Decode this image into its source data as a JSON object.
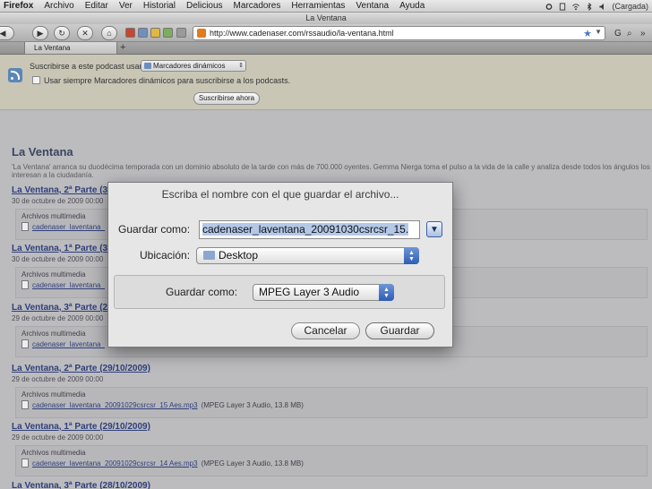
{
  "menubar": {
    "app": "Firefox",
    "items": [
      "Archivo",
      "Editar",
      "Ver",
      "Historial",
      "Delicious",
      "Marcadores",
      "Herramientas",
      "Ventana",
      "Ayuda"
    ],
    "status": "(Cargada)"
  },
  "window": {
    "title": "La Ventana"
  },
  "navbar": {
    "url": "http://www.cadenaser.com/rssaudio/la-ventana.html"
  },
  "tabs": [
    {
      "label": "La Ventana"
    }
  ],
  "subscribe": {
    "prompt": "Suscribirse a este podcast usando",
    "reader": "Marcadores dinámicos",
    "always_label": "Usar siempre Marcadores dinámicos para suscribirse a los podcasts.",
    "button": "Suscribirse ahora"
  },
  "feed": {
    "title": "La Ventana",
    "description_line1": "'La Ventana' arranca su duodécima temporada con un dominio absoluto de la tarde con más de 700.000 oyentes. Gemma Nierga toma el pulso a la vida de la calle y analiza desde todos los ángulos los",
    "description_line2": "interesan a la ciudadanía."
  },
  "entries": [
    {
      "title": "La Ventana, 2ª Parte (30/1",
      "date": "30 de octubre de 2009 00:00",
      "media_label": "Archivos multimedia",
      "file": "cadenaser_laventana_",
      "info": ""
    },
    {
      "title": "La Ventana, 1ª Parte (30/1",
      "date": "30 de octubre de 2009 00:00",
      "media_label": "Archivos multimedia",
      "file": "cadenaser_laventana_",
      "info": ""
    },
    {
      "title": "La Ventana, 3ª Parte (29/1",
      "date": "29 de octubre de 2009 00:00",
      "media_label": "Archivos multimedia",
      "file": "cadenaser_laventana_",
      "info": ""
    },
    {
      "title": "La Ventana, 2ª Parte (29/10/2009)",
      "date": "29 de octubre de 2009 00:00",
      "media_label": "Archivos multimedia",
      "file": "cadenaser_laventana_20091029csrcsr_15 Aes.mp3",
      "info": "(MPEG Layer 3 Audio, 13.8 MB)"
    },
    {
      "title": "La Ventana, 1ª Parte (29/10/2009)",
      "date": "29 de octubre de 2009 00:00",
      "media_label": "Archivos multimedia",
      "file": "cadenaser_laventana_20091029csrcsr_14 Aes.mp3",
      "info": "(MPEG Layer 3 Audio, 13.8 MB)"
    },
    {
      "title": "La Ventana, 3ª Parte (28/10/2009)",
      "date": "",
      "media_label": "",
      "file": "",
      "info": ""
    }
  ],
  "dialog": {
    "title": "Escriba el nombre con el que guardar el archivo...",
    "name_label": "Guardar como:",
    "name_value": "cadenaser_laventana_20091030csrcsr_15.",
    "location_label": "Ubicación:",
    "location_value": "Desktop",
    "format_label": "Guardar como:",
    "format_value": "MPEG Layer 3 Audio",
    "cancel": "Cancelar",
    "save": "Guardar"
  }
}
